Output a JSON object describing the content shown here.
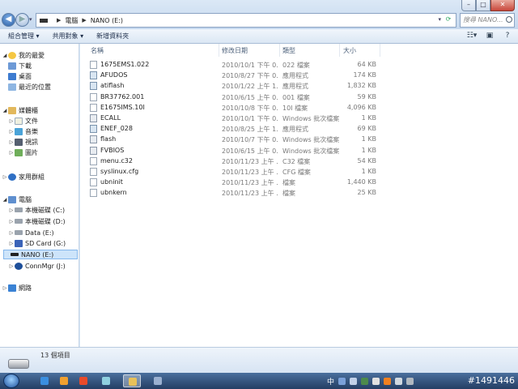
{
  "window": {
    "breadcrumb": [
      "電腦",
      "NANO (E:)"
    ],
    "search_placeholder": "搜尋 NANO..."
  },
  "toolbar": {
    "organize": "組合管理 ▾",
    "share": "共用對象 ▾",
    "new_folder": "新增資料夾"
  },
  "nav": {
    "favorites": "我的最愛",
    "downloads": "下載",
    "desktop": "桌面",
    "recent": "最近的位置",
    "libraries": "媒體櫃",
    "documents": "文件",
    "music": "音樂",
    "videos": "視訊",
    "pictures": "圖片",
    "homegroup": "家用群組",
    "computer": "電腦",
    "drive_c": "本機磁碟 (C:)",
    "drive_d": "本機磁碟 (D:)",
    "drive_e": "Data (E:)",
    "drive_g": "SD Card (G:)",
    "drive_nano": "NANO (E:)",
    "drive_j": "ConnMgr (J:)",
    "network": "網路"
  },
  "columns": {
    "name": "名稱",
    "date": "修改日期",
    "type": "類型",
    "size": "大小"
  },
  "files": [
    {
      "name": "1675EMS1.022",
      "date": "2010/10/1 下午 0...",
      "type": "022 檔案",
      "size": "64 KB",
      "icon": "file"
    },
    {
      "name": "AFUDOS",
      "date": "2010/8/27 下午 0...",
      "type": "應用程式",
      "size": "174 KB",
      "icon": "exe"
    },
    {
      "name": "atiflash",
      "date": "2010/1/22 上午 1...",
      "type": "應用程式",
      "size": "1,832 KB",
      "icon": "exe"
    },
    {
      "name": "BR37762.001",
      "date": "2010/6/15 上午 0...",
      "type": "001 檔案",
      "size": "59 KB",
      "icon": "file"
    },
    {
      "name": "E1675IMS.10I",
      "date": "2010/10/8 下午 0...",
      "type": "10I 檔案",
      "size": "4,096 KB",
      "icon": "file"
    },
    {
      "name": "ECALL",
      "date": "2010/10/1 下午 0...",
      "type": "Windows 批次檔案",
      "size": "1 KB",
      "icon": "bat"
    },
    {
      "name": "ENEF_028",
      "date": "2010/8/25 上午 1...",
      "type": "應用程式",
      "size": "69 KB",
      "icon": "exe"
    },
    {
      "name": "flash",
      "date": "2010/10/7 下午 0...",
      "type": "Windows 批次檔案",
      "size": "1 KB",
      "icon": "bat"
    },
    {
      "name": "FVBIOS",
      "date": "2010/6/15 上午 0...",
      "type": "Windows 批次檔案",
      "size": "1 KB",
      "icon": "bat"
    },
    {
      "name": "menu.c32",
      "date": "2010/11/23 上午 ...",
      "type": "C32 檔案",
      "size": "54 KB",
      "icon": "file"
    },
    {
      "name": "syslinux.cfg",
      "date": "2010/11/23 上午 ...",
      "type": "CFG 檔案",
      "size": "1 KB",
      "icon": "file"
    },
    {
      "name": "ubninit",
      "date": "2010/11/23 上午 ...",
      "type": "檔案",
      "size": "1,440 KB",
      "icon": "file"
    },
    {
      "name": "ubnkern",
      "date": "2010/11/23 上午 ...",
      "type": "檔案",
      "size": "25 KB",
      "icon": "file"
    }
  ],
  "status": {
    "item_count": "13 個項目"
  },
  "taskbar": {
    "ime": "中",
    "watermark": "#1491446"
  }
}
